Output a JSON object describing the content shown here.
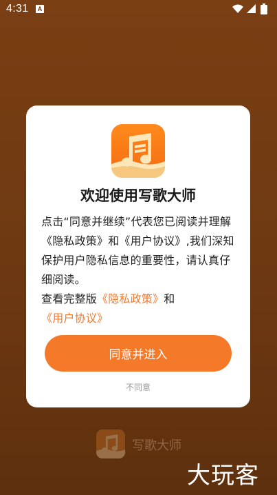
{
  "status_bar": {
    "time": "4:31",
    "notification_badge": "A"
  },
  "dialog": {
    "title": "欢迎使用写歌大师",
    "body_part1": "点击“同意并继续”代表您已阅读并理解《隐私政策》和《用户协议》,我们深知保护用户隐私信息的重要性，请认真仔细阅读。",
    "body_part2_prefix": "查看完整版",
    "privacy_link": "《隐私政策》",
    "and_text": "和",
    "user_agreement_link": "《用户协议》",
    "agree_label": "同意并进入",
    "disagree_label": "不同意"
  },
  "splash": {
    "app_name": "写歌大师"
  },
  "watermark": {
    "text": "大玩客"
  },
  "colors": {
    "background": "#6d3811",
    "accent": "#f47a2a",
    "link": "#f07a2d",
    "icon_orange": "#ff8a1c",
    "icon_cream": "#fde7b8"
  },
  "icons": {
    "app": "music-note-icon",
    "wifi": "wifi-icon",
    "signal": "cell-signal-icon",
    "battery": "battery-icon"
  }
}
